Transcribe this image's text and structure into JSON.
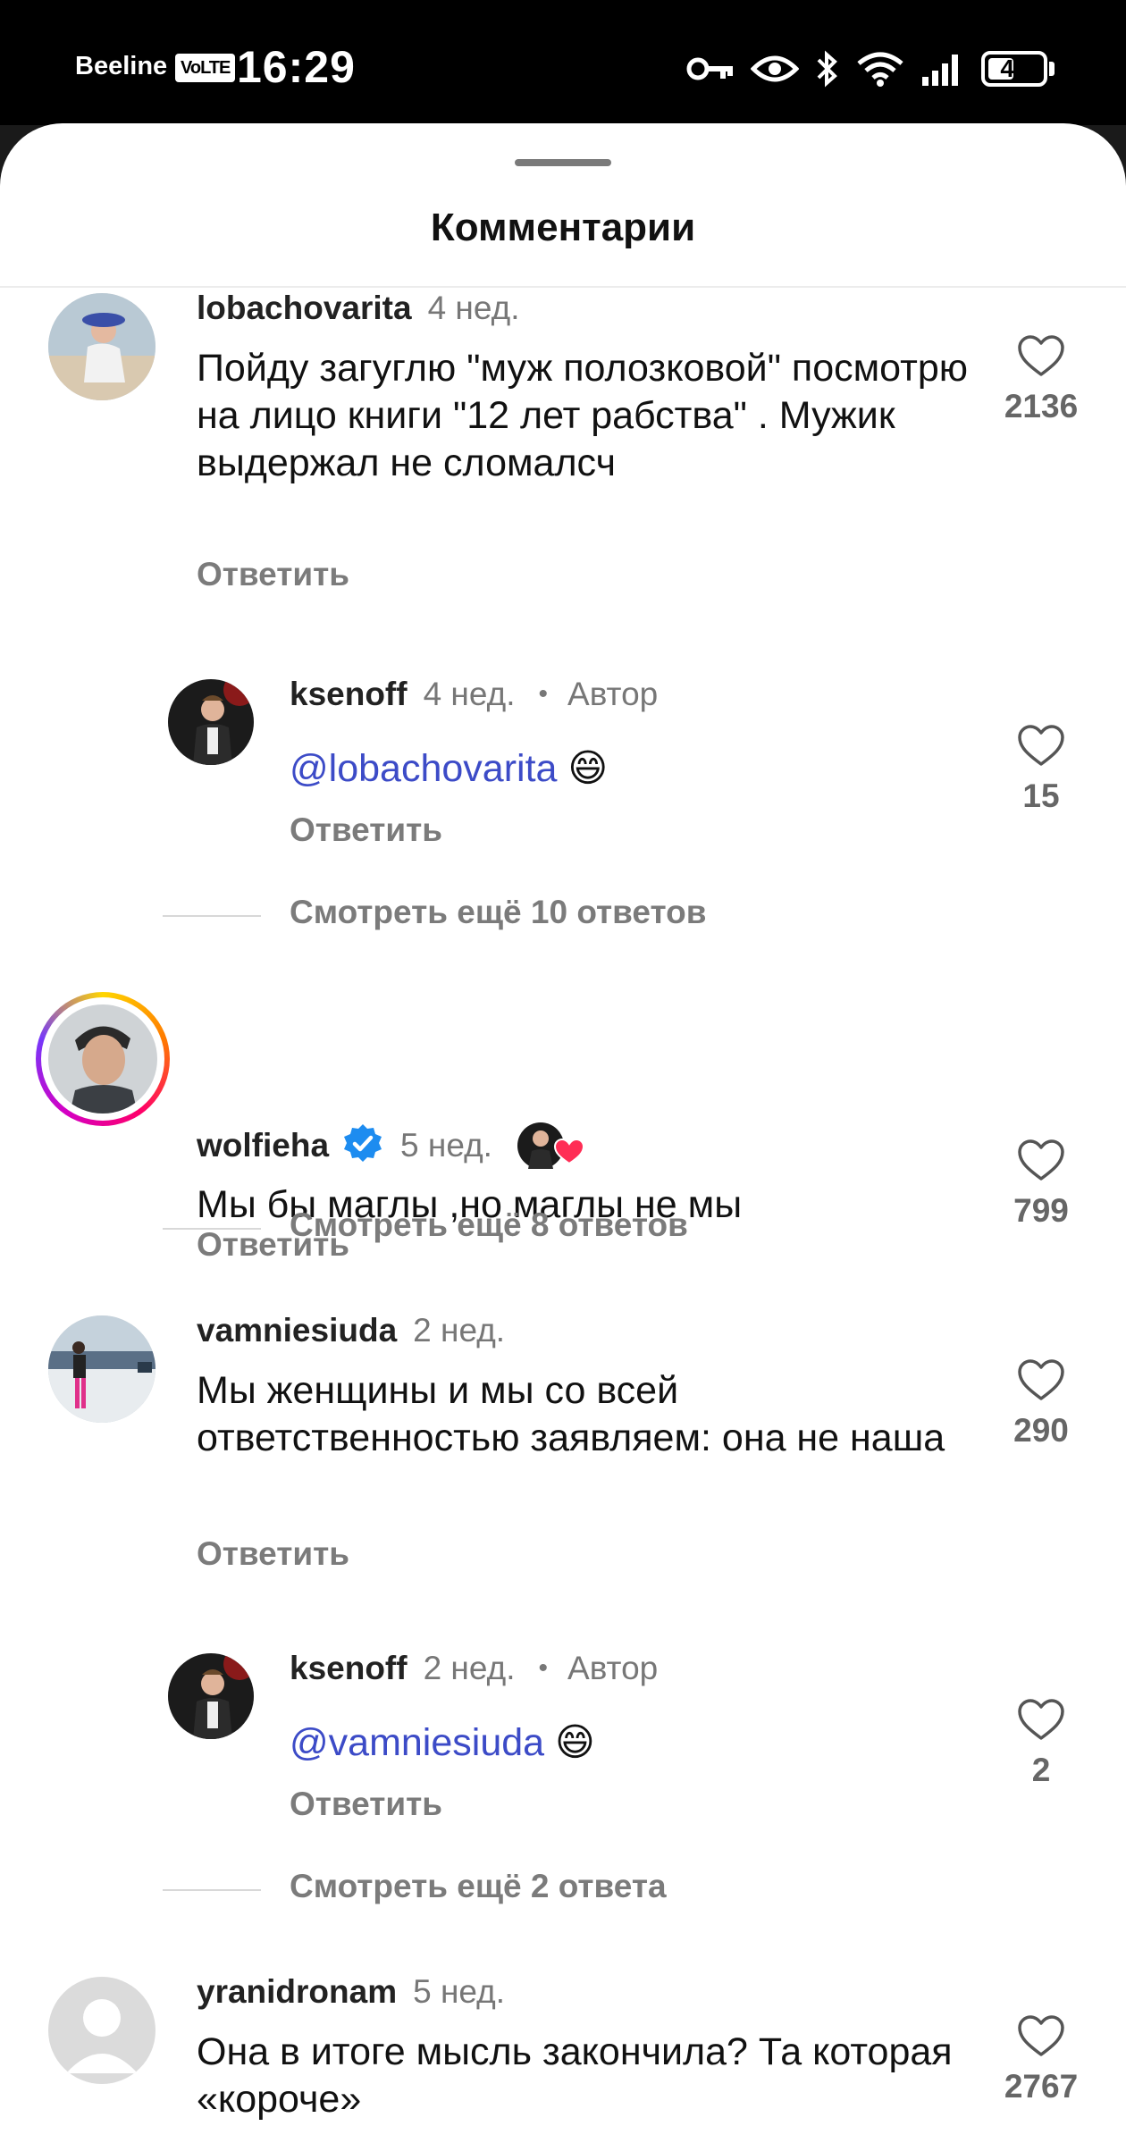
{
  "status_bar": {
    "carrier": "Beeline",
    "volte": "VoLTE",
    "time": "16:29",
    "battery": "49",
    "battery_level": 0.49,
    "icons": [
      "key-icon",
      "eye-icon",
      "bluetooth-icon",
      "wifi-icon",
      "signal-icon",
      "battery-icon"
    ]
  },
  "sheet": {
    "title": "Комментарии"
  },
  "reply_label": "Ответить",
  "author_label": "Автор",
  "comments": [
    {
      "username": "lobachovarita",
      "time": "4 нед.",
      "text": "Пойду загуглю \"муж полозковой\" посмотрю на лицо книги \"12 лет рабства\" . Мужик выдержал не сломалсч",
      "likes": "2136"
    },
    {
      "username": "ksenoff",
      "time": "4 нед.",
      "mention": "@lobachovarita",
      "emoji": "😄",
      "likes": "15",
      "more_replies": "Смотреть ещё 10 ответов"
    },
    {
      "username": "wolfieha",
      "time": "5 нед.",
      "text": "Мы бы маглы ,но маглы не мы",
      "likes": "799",
      "more_replies": "Смотреть ещё 8 ответов"
    },
    {
      "username": "vamniesiuda",
      "time": "2 нед.",
      "text": "Мы женщины и мы со всей ответственностью заявляем: она не наша",
      "likes": "290"
    },
    {
      "username": "ksenoff",
      "time": "2 нед.",
      "mention": "@vamniesiuda",
      "emoji": "😄",
      "likes": "2",
      "more_replies": "Смотреть ещё 2 ответа"
    },
    {
      "username": "yranidronam",
      "time": "5 нед.",
      "text": "Она в итоге мысль закончила? Та которая «короче»",
      "likes": "2767"
    }
  ],
  "colors": {
    "mention": "#3c4bc7",
    "verified": "#1d8cf0",
    "like_heart_small": "#ff2d55"
  }
}
